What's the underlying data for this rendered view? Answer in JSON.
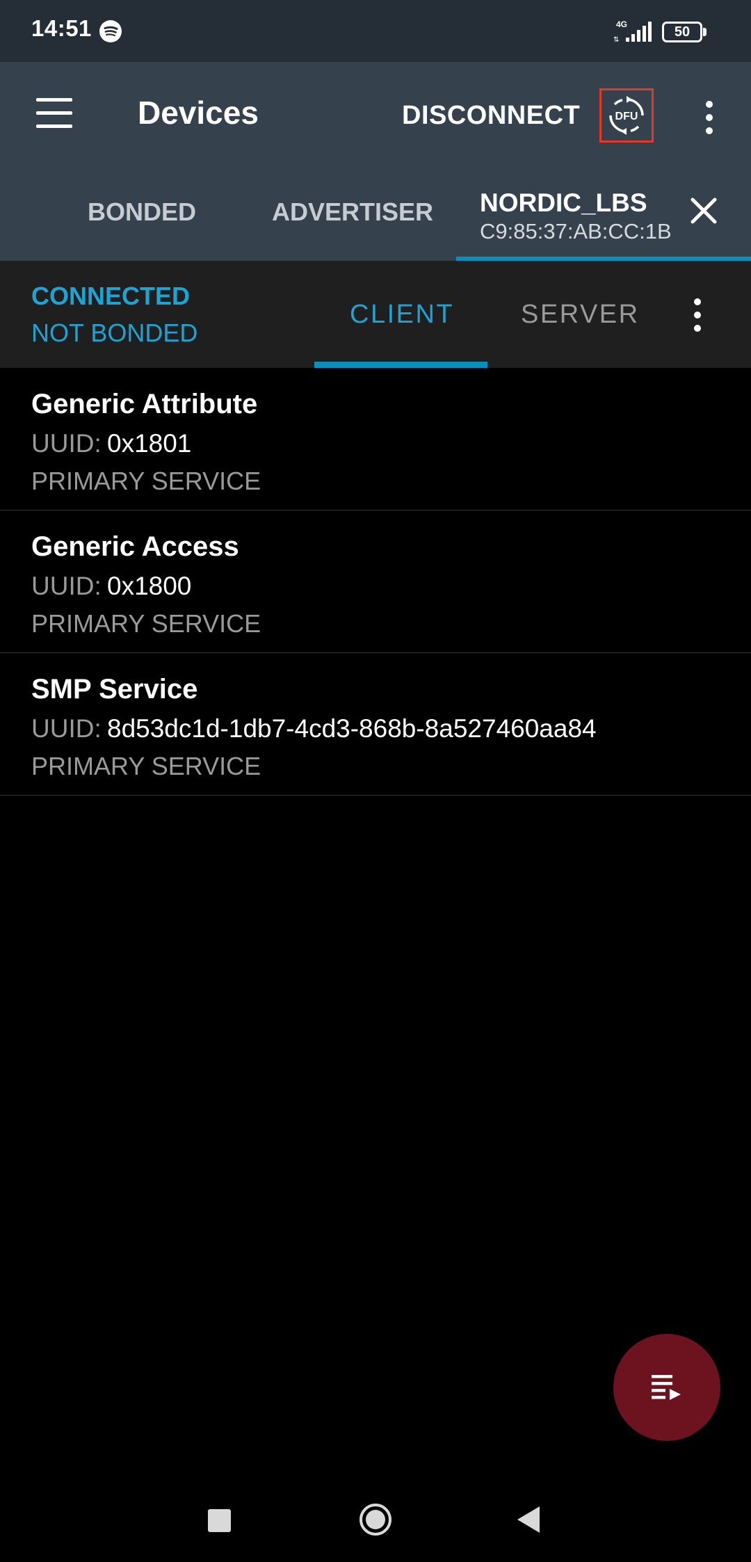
{
  "status_bar": {
    "time": "14:51",
    "network_type": "4G",
    "battery_level": "50"
  },
  "app_bar": {
    "title": "Devices",
    "disconnect_label": "DISCONNECT",
    "dfu_label": "DFU"
  },
  "device_tabs": [
    {
      "label": "BONDED"
    },
    {
      "label": "ADVERTISER"
    }
  ],
  "active_device": {
    "name": "NORDIC_LBS",
    "address": "C9:85:37:AB:CC:1B"
  },
  "connection": {
    "state": "CONNECTED",
    "bond_state": "NOT BONDED"
  },
  "role_tabs": {
    "client_label": "CLIENT",
    "server_label": "SERVER",
    "selected": "CLIENT"
  },
  "services": [
    {
      "name": "Generic Attribute",
      "uuid_label": "UUID:",
      "uuid": "0x1801",
      "type": "PRIMARY SERVICE"
    },
    {
      "name": "Generic Access",
      "uuid_label": "UUID:",
      "uuid": "0x1800",
      "type": "PRIMARY SERVICE"
    },
    {
      "name": "SMP Service",
      "uuid_label": "UUID:",
      "uuid": "8d53dc1d-1db7-4cd3-868b-8a527460aa84",
      "type": "PRIMARY SERVICE"
    }
  ],
  "icons": {
    "menu": "hamburger-menu-icon",
    "dfu": "dfu-icon",
    "overflow": "more-vert-icon",
    "close": "close-icon",
    "fab": "log-playlist-icon"
  },
  "colors": {
    "accent": "#1ea3d3",
    "app_bar": "#35414d",
    "status_bar": "#252d36",
    "fab": "#6d1320",
    "dfu_highlight": "#e53927"
  }
}
